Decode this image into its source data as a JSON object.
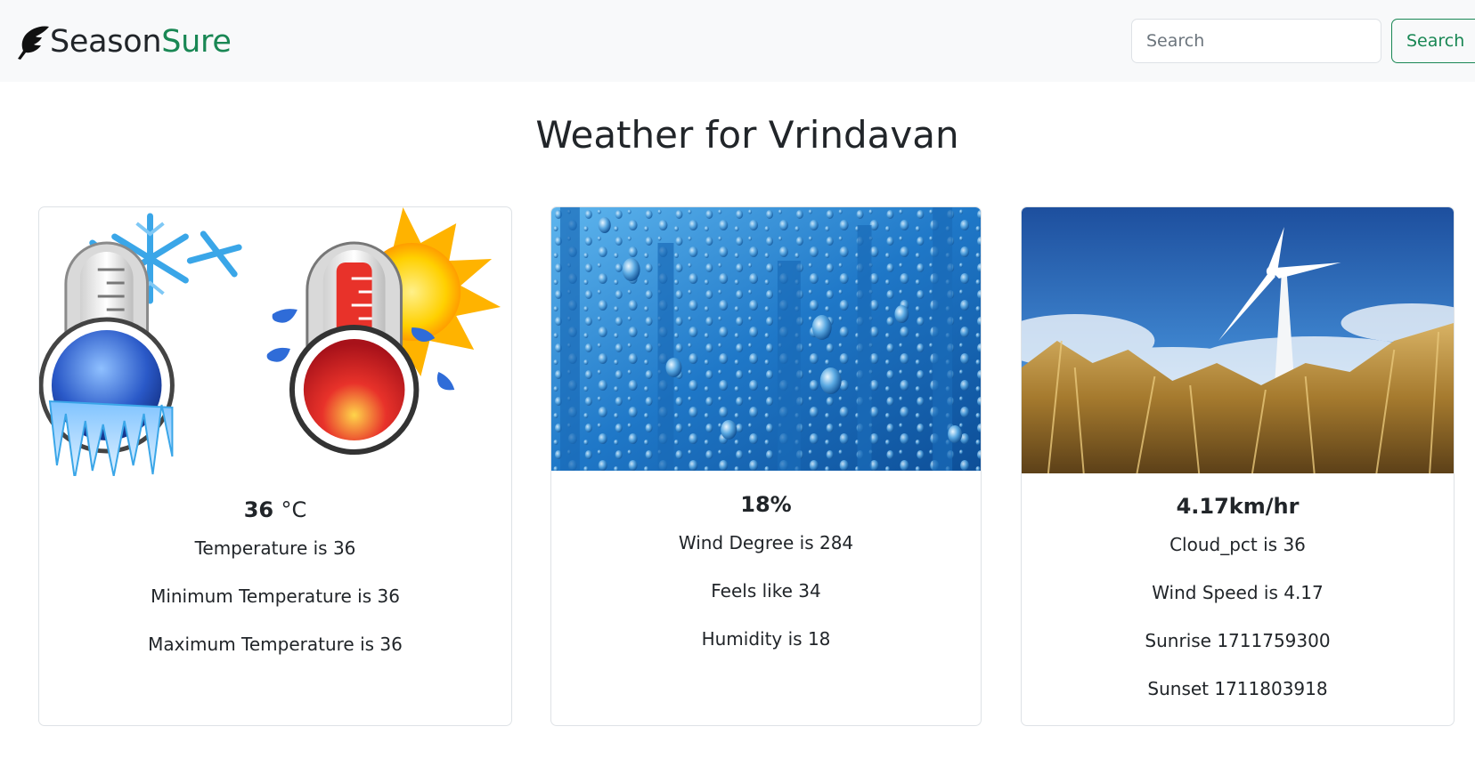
{
  "brand": {
    "name_part1": "Season",
    "name_part2": "Sure",
    "logo_icon": "feather-quill-icon"
  },
  "search": {
    "placeholder": "Search",
    "button_label": "Search"
  },
  "page": {
    "title": "Weather for Vrindavan"
  },
  "cards": {
    "temperature": {
      "image": "thermometer-cold-hot-illustration",
      "title_value": "36",
      "title_unit": "°C",
      "lines": [
        "Temperature is 36",
        "Minimum Temperature is 36",
        "Maximum Temperature is 36"
      ]
    },
    "humidity": {
      "image": "water-droplets-on-glass",
      "title": "18%",
      "lines": [
        "Wind Degree is 284",
        "Feels like 34",
        "Humidity is 18"
      ]
    },
    "wind": {
      "image": "wind-turbine-wheat-field",
      "title": "4.17km/hr",
      "lines": [
        "Cloud_pct is 36",
        "Wind Speed is 4.17",
        "Sunrise 1711759300",
        "Sunset 1711803918"
      ]
    }
  },
  "colors": {
    "brand_green": "#198754",
    "navbar_bg": "#f8f9fa",
    "text": "#212529",
    "border": "#dee2e6"
  }
}
